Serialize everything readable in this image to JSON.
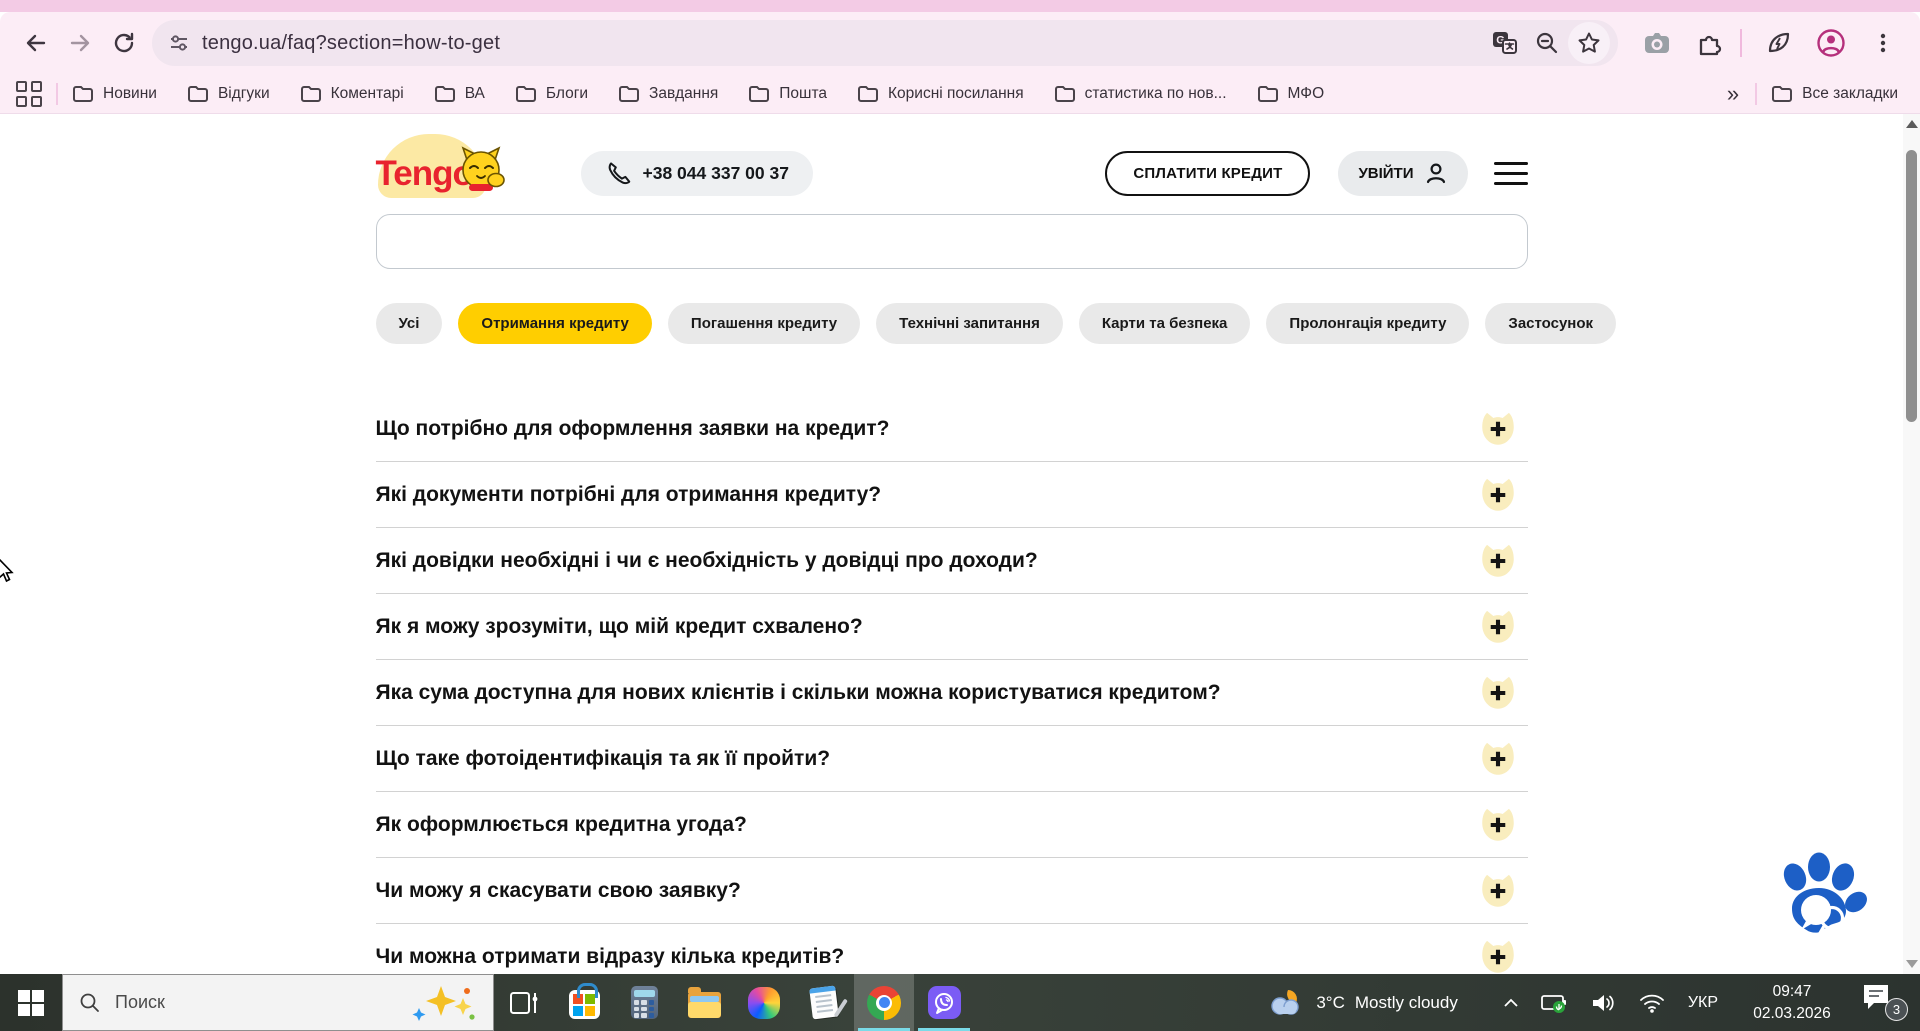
{
  "browser": {
    "url": "tengo.ua/faq?section=how-to-get",
    "bookmarks": {
      "items": [
        "Новини",
        "Відгуки",
        "Коментарі",
        "ВА",
        "Блоги",
        "Завдання",
        "Пошта",
        "Корисні посилання",
        "статистика по нов...",
        "МФО"
      ],
      "overflow_chevron": "»",
      "all_bookmarks": "Все закладки"
    }
  },
  "site": {
    "logo_text": "Tengo",
    "phone": "+38 044 337 00 37",
    "pay_button": "СПЛАТИТИ КРЕДИТ",
    "login_button": "УВІЙТИ",
    "search_value": "",
    "filters": [
      "Усі",
      "Отримання кредиту",
      "Погашення кредиту",
      "Технічні запитання",
      "Карти та безпека",
      "Пролонгація кредиту",
      "Застосунок"
    ],
    "active_filter": "Отримання кредиту",
    "faq": [
      "Що потрібно для оформлення заявки на кредит?",
      "Які документи потрібні для отримання кредиту?",
      "Які довідки необхідні і чи є необхідність у довідці про доходи?",
      "Як я можу зрозуміти, що мій кредит схвалено?",
      "Яка сума доступна для нових клієнтів і скільки можна користуватися кредитом?",
      "Що таке фотоідентифікація та як її пройти?",
      "Як оформлюється кредитна угода?",
      "Чи можу я скасувати свою заявку?",
      "Чи можна отримати відразу кілька кредитів?"
    ]
  },
  "taskbar": {
    "search_placeholder": "Поиск",
    "weather": {
      "temp": "3°C",
      "condition": "Mostly cloudy"
    },
    "language": "УКР",
    "clock": {
      "time": "09:47",
      "date": "02.03.2026"
    },
    "notification_count": "3"
  },
  "colors": {
    "browser_pink": "#fcedf6",
    "omnibox_pink": "#f1e5ef",
    "accent_yellow": "#ffce00",
    "pale_yellow_plus": "#f9edbe",
    "brand_red": "#e8232e",
    "paw_blue": "#1d5fc6",
    "viber_purple": "#7b5cf5",
    "taskbar_underline": "#7adbe8"
  }
}
